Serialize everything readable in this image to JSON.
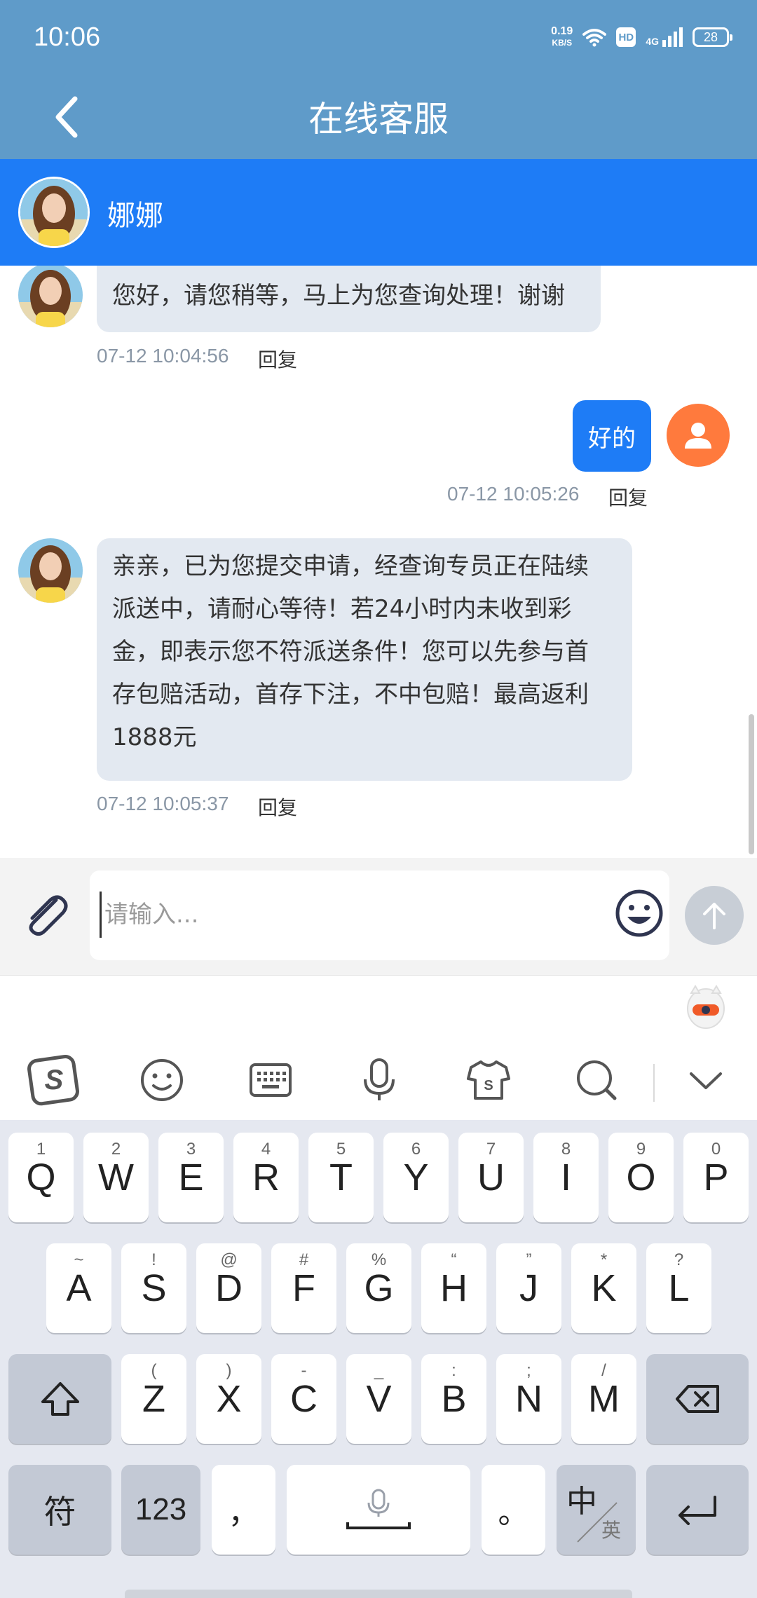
{
  "status_bar": {
    "time": "10:06",
    "net_speed_value": "0.19",
    "net_speed_unit": "KB/S",
    "hd": "HD",
    "signal": "4G",
    "battery": "28"
  },
  "header": {
    "title": "在线客服"
  },
  "agent": {
    "name": "娜娜"
  },
  "messages": [
    {
      "side": "left",
      "text": "您好，请您稍等，马上为您查询处理！谢谢",
      "time": "07-12 10:04:56",
      "reply": "回复"
    },
    {
      "side": "right",
      "text": "好的",
      "time": "07-12 10:05:26",
      "reply": "回复"
    },
    {
      "side": "left",
      "lines": [
        "亲亲，已为您提交申请，经查询专员正在陆续",
        "派送中，请耐心等待！若24小时内未收到彩",
        "金，即表示您不符派送条件！您可以先参与首",
        "存包赔活动，首存下注，不中包赔！最高返利",
        "1888元"
      ],
      "time": "07-12 10:05:37",
      "reply": "回复"
    }
  ],
  "input": {
    "placeholder": "请输入..."
  },
  "keyboard": {
    "row1": [
      {
        "main": "Q",
        "sub": "1"
      },
      {
        "main": "W",
        "sub": "2"
      },
      {
        "main": "E",
        "sub": "3"
      },
      {
        "main": "R",
        "sub": "4"
      },
      {
        "main": "T",
        "sub": "5"
      },
      {
        "main": "Y",
        "sub": "6"
      },
      {
        "main": "U",
        "sub": "7"
      },
      {
        "main": "I",
        "sub": "8"
      },
      {
        "main": "O",
        "sub": "9"
      },
      {
        "main": "P",
        "sub": "0"
      }
    ],
    "row2": [
      {
        "main": "A",
        "sub": "~"
      },
      {
        "main": "S",
        "sub": "!"
      },
      {
        "main": "D",
        "sub": "@"
      },
      {
        "main": "F",
        "sub": "#"
      },
      {
        "main": "G",
        "sub": "%"
      },
      {
        "main": "H",
        "sub": "“"
      },
      {
        "main": "J",
        "sub": "”"
      },
      {
        "main": "K",
        "sub": "*"
      },
      {
        "main": "L",
        "sub": "?"
      }
    ],
    "row3": [
      {
        "main": "Z",
        "sub": "("
      },
      {
        "main": "X",
        "sub": ")"
      },
      {
        "main": "C",
        "sub": "-"
      },
      {
        "main": "V",
        "sub": "_"
      },
      {
        "main": "B",
        "sub": ":"
      },
      {
        "main": "N",
        "sub": ";"
      },
      {
        "main": "M",
        "sub": "/"
      }
    ],
    "symbols_label": "符",
    "numbers_label": "123",
    "comma": "，",
    "period": "。",
    "lang_zh": "中",
    "lang_en": "英"
  },
  "colors": {
    "header_bg": "#5f9bc9",
    "agent_bar_bg": "#1e7cf6",
    "bubble_left_bg": "#e3e9f1",
    "bubble_right_bg": "#1e7cf6",
    "user_avatar_bg": "#ff7a3d"
  }
}
